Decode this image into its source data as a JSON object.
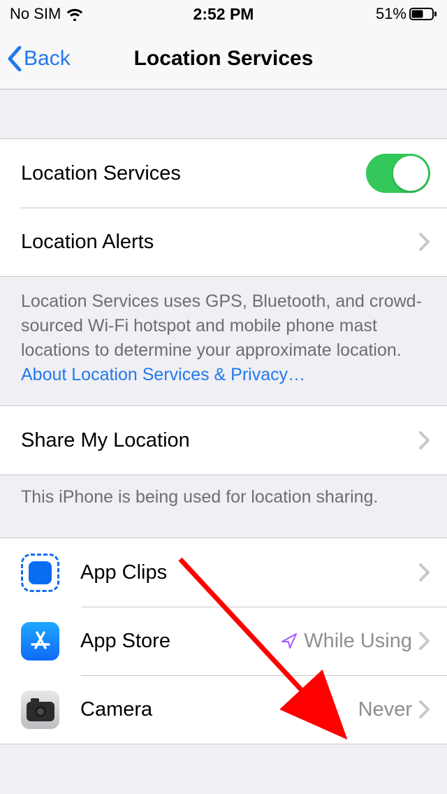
{
  "status": {
    "carrier": "No SIM",
    "time": "2:52 PM",
    "battery_pct": "51%"
  },
  "nav": {
    "back_label": "Back",
    "title": "Location Services"
  },
  "rows": {
    "location_services": "Location Services",
    "location_alerts": "Location Alerts",
    "share_my_location": "Share My Location"
  },
  "footer1_text": "Location Services uses GPS, Bluetooth, and crowd-sourced Wi-Fi hotspot and mobile phone mast locations to determine your approximate location. ",
  "footer1_link": "About Location Services & Privacy…",
  "footer2_text": "This iPhone is being used for location sharing.",
  "apps": {
    "app_clips": {
      "label": "App Clips",
      "value": ""
    },
    "app_store": {
      "label": "App Store",
      "value": "While Using"
    },
    "camera": {
      "label": "Camera",
      "value": "Never"
    }
  }
}
